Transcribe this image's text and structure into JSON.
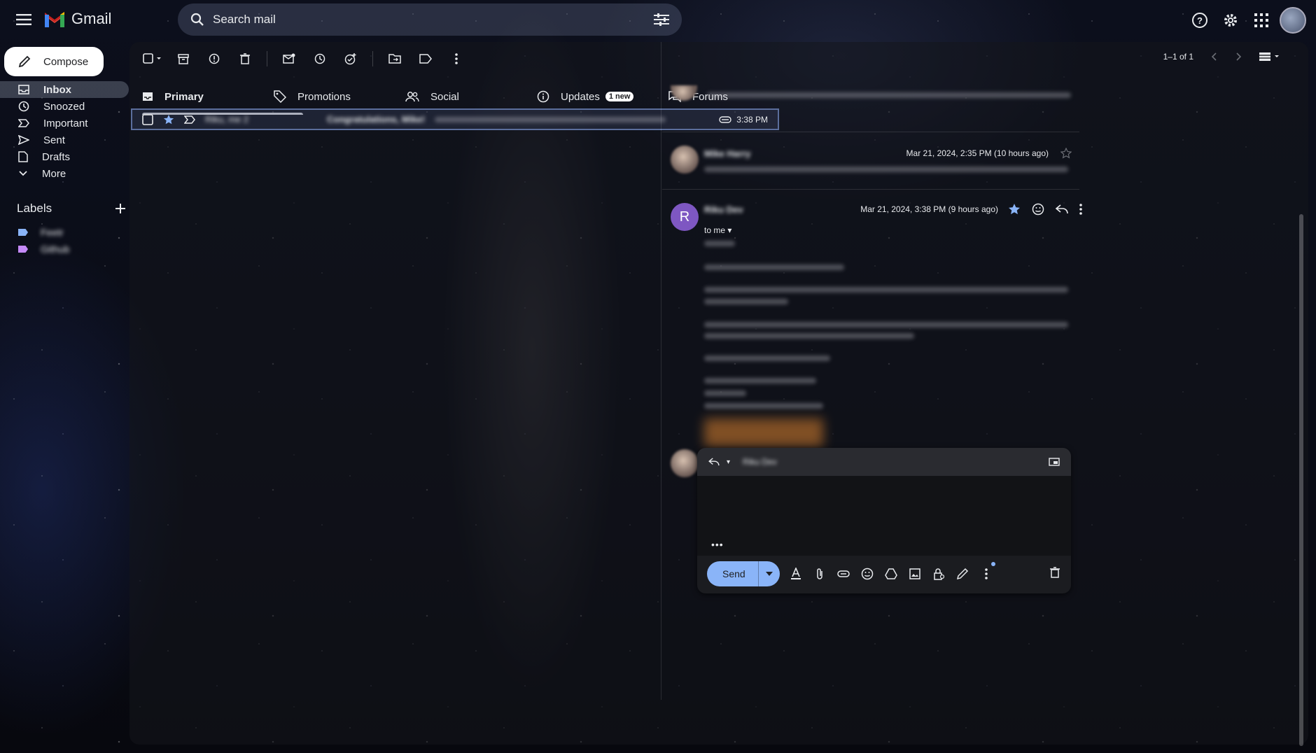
{
  "app": {
    "name": "Gmail"
  },
  "search": {
    "placeholder": "Search mail"
  },
  "sidebar": {
    "compose_label": "Compose",
    "items": [
      {
        "label": "Inbox",
        "icon": "inbox-icon",
        "active": true
      },
      {
        "label": "Snoozed",
        "icon": "clock-icon"
      },
      {
        "label": "Important",
        "icon": "important-icon"
      },
      {
        "label": "Sent",
        "icon": "send-icon"
      },
      {
        "label": "Drafts",
        "icon": "draft-icon"
      },
      {
        "label": "More",
        "icon": "chevron-down-icon"
      }
    ],
    "labels_heading": "Labels",
    "labels": [
      {
        "label": "Feetr",
        "color": "#8ab4f8"
      },
      {
        "label": "Github",
        "color": "#c58af9"
      }
    ]
  },
  "toolbar": {
    "pager_text": "1–1 of 1"
  },
  "tabs": [
    {
      "label": "Primary",
      "icon": "inbox-icon",
      "selected": true
    },
    {
      "label": "Promotions",
      "icon": "tag-icon"
    },
    {
      "label": "Social",
      "icon": "people-icon"
    },
    {
      "label": "Updates",
      "icon": "info-icon",
      "badge": "1 new"
    },
    {
      "label": "Forums",
      "icon": "forum-icon"
    }
  ],
  "mail_list": [
    {
      "sender": "Riku, me 2",
      "subject": "Congratulations, Mike!",
      "time": "3:38 PM",
      "starred": true
    }
  ],
  "thread": {
    "messages": [
      {
        "sender": "Mike Harry",
        "date": "Mar 21, 2024, 2:35 PM (10 hours ago)"
      },
      {
        "sender": "Riku Dev",
        "initial": "R",
        "date": "Mar 21, 2024, 3:38 PM (9 hours ago)",
        "to": "to me",
        "starred": true
      }
    ],
    "reply": {
      "send_label": "Send",
      "recipient": "Riku Dev"
    }
  },
  "colors": {
    "accent": "#8ab4f8",
    "avatar": "#7e57c2"
  }
}
